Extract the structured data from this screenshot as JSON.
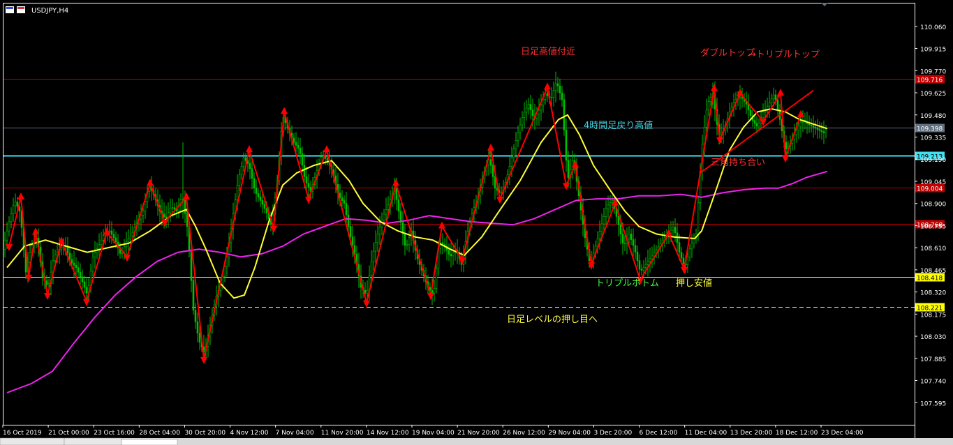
{
  "window": {
    "title": "USDJPY,H4"
  },
  "colors": {
    "background": "#000000",
    "frame": "#ffffff",
    "candle": "#00c000",
    "red_level": "#c00000",
    "cyan_level": "#40e0f0",
    "yellow_level": "#ffff00",
    "gray_level": "#607080",
    "ma_short": "#ffff33",
    "ma_long": "#ee22ee",
    "arrow": "#ff0000",
    "annotation_red": "#ff3030",
    "annotation_cyan": "#40d0e0",
    "annotation_green": "#40ff40",
    "annotation_yellow": "#ffff40"
  },
  "chart_data": {
    "type": "candlestick",
    "symbol": "USDJPY",
    "timeframe": "H4",
    "ylim": [
      107.45,
      110.21
    ],
    "y_ticks": [
      "110.060",
      "109.915",
      "109.770",
      "109.625",
      "109.480",
      "109.335",
      "109.190",
      "109.045",
      "108.900",
      "108.755",
      "108.610",
      "108.465",
      "108.320",
      "108.175",
      "108.030",
      "107.885",
      "107.740",
      "107.595"
    ],
    "x_ticks": [
      "16 Oct 2019",
      "21 Oct 00:00",
      "23 Oct 16:00",
      "28 Oct 04:00",
      "30 Oct 20:00",
      "4 Nov 12:00",
      "7 Nov 04:00",
      "11 Nov 20:00",
      "14 Nov 12:00",
      "19 Nov 04:00",
      "21 Nov 20:00",
      "26 Nov 12:00",
      "29 Nov 04:00",
      "3 Dec 20:00",
      "6 Dec 12:00",
      "11 Dec 04:00",
      "13 Dec 20:00",
      "18 Dec 12:00",
      "23 Dec 04:00"
    ],
    "horizontal_levels": [
      {
        "value": 109.716,
        "label": "109.716",
        "style": "solid",
        "color": "#c00000"
      },
      {
        "value": 109.398,
        "label": "109.398",
        "style": "solid",
        "color": "#607080"
      },
      {
        "value": 109.213,
        "label": "109.213",
        "style": "solid",
        "color": "#40e0f0"
      },
      {
        "value": 109.004,
        "label": "109.004",
        "style": "solid",
        "color": "#c00000"
      },
      {
        "value": 108.768,
        "label": "108.768",
        "style": "solid",
        "color": "#c00000"
      },
      {
        "value": 108.418,
        "label": "108.418",
        "style": "solid",
        "color": "#ffff00"
      },
      {
        "value": 108.221,
        "label": "108.221",
        "style": "dashed",
        "color": "#ffff00"
      }
    ],
    "price_path": [
      [
        0,
        108.62
      ],
      [
        8,
        108.78
      ],
      [
        16,
        108.92
      ],
      [
        24,
        108.84
      ],
      [
        32,
        108.45
      ],
      [
        40,
        108.62
      ],
      [
        48,
        108.68
      ],
      [
        56,
        108.42
      ],
      [
        64,
        108.35
      ],
      [
        72,
        108.55
      ],
      [
        80,
        108.6
      ],
      [
        88,
        108.63
      ],
      [
        96,
        108.52
      ],
      [
        104,
        108.48
      ],
      [
        112,
        108.4
      ],
      [
        120,
        108.3
      ],
      [
        128,
        108.55
      ],
      [
        136,
        108.62
      ],
      [
        144,
        108.7
      ],
      [
        152,
        108.72
      ],
      [
        160,
        108.66
      ],
      [
        168,
        108.56
      ],
      [
        176,
        108.65
      ],
      [
        184,
        108.7
      ],
      [
        192,
        108.78
      ],
      [
        200,
        108.85
      ],
      [
        208,
        109.02
      ],
      [
        216,
        108.95
      ],
      [
        224,
        108.85
      ],
      [
        232,
        108.8
      ],
      [
        240,
        108.88
      ],
      [
        248,
        108.85
      ],
      [
        256,
        108.95
      ],
      [
        264,
        108.72
      ],
      [
        272,
        108.2
      ],
      [
        280,
        108.0
      ],
      [
        288,
        107.92
      ],
      [
        296,
        108.1
      ],
      [
        304,
        108.28
      ],
      [
        312,
        108.38
      ],
      [
        320,
        108.55
      ],
      [
        328,
        108.8
      ],
      [
        336,
        109.05
      ],
      [
        344,
        109.2
      ],
      [
        352,
        109.15
      ],
      [
        360,
        108.98
      ],
      [
        368,
        108.92
      ],
      [
        376,
        108.85
      ],
      [
        384,
        108.75
      ],
      [
        392,
        109.05
      ],
      [
        400,
        109.48
      ],
      [
        408,
        109.38
      ],
      [
        416,
        109.3
      ],
      [
        424,
        109.25
      ],
      [
        432,
        109.05
      ],
      [
        440,
        108.98
      ],
      [
        448,
        109.1
      ],
      [
        456,
        109.22
      ],
      [
        464,
        109.18
      ],
      [
        472,
        109.1
      ],
      [
        480,
        108.95
      ],
      [
        488,
        108.9
      ],
      [
        496,
        108.7
      ],
      [
        504,
        108.55
      ],
      [
        512,
        108.35
      ],
      [
        520,
        108.3
      ],
      [
        528,
        108.55
      ],
      [
        536,
        108.7
      ],
      [
        544,
        108.82
      ],
      [
        552,
        108.9
      ],
      [
        560,
        109.0
      ],
      [
        568,
        108.8
      ],
      [
        576,
        108.6
      ],
      [
        584,
        108.72
      ],
      [
        592,
        108.55
      ],
      [
        600,
        108.45
      ],
      [
        608,
        108.35
      ],
      [
        616,
        108.3
      ],
      [
        624,
        108.65
      ],
      [
        632,
        108.62
      ],
      [
        640,
        108.55
      ],
      [
        648,
        108.6
      ],
      [
        656,
        108.5
      ],
      [
        664,
        108.7
      ],
      [
        672,
        108.85
      ],
      [
        680,
        108.95
      ],
      [
        688,
        109.1
      ],
      [
        696,
        109.2
      ],
      [
        704,
        109.0
      ],
      [
        712,
        108.96
      ],
      [
        720,
        109.05
      ],
      [
        728,
        109.2
      ],
      [
        736,
        109.35
      ],
      [
        744,
        109.48
      ],
      [
        752,
        109.55
      ],
      [
        760,
        109.45
      ],
      [
        768,
        109.52
      ],
      [
        776,
        109.62
      ],
      [
        784,
        109.58
      ],
      [
        792,
        109.7
      ],
      [
        800,
        109.58
      ],
      [
        808,
        109.05
      ],
      [
        816,
        109.2
      ],
      [
        824,
        108.95
      ],
      [
        832,
        108.7
      ],
      [
        840,
        108.5
      ],
      [
        848,
        108.62
      ],
      [
        856,
        108.75
      ],
      [
        864,
        108.88
      ],
      [
        872,
        108.92
      ],
      [
        880,
        108.78
      ],
      [
        888,
        108.62
      ],
      [
        896,
        108.7
      ],
      [
        904,
        108.6
      ],
      [
        912,
        108.45
      ],
      [
        920,
        108.5
      ],
      [
        928,
        108.55
      ],
      [
        936,
        108.6
      ],
      [
        944,
        108.66
      ],
      [
        952,
        108.7
      ],
      [
        960,
        108.75
      ],
      [
        968,
        108.58
      ],
      [
        976,
        108.48
      ],
      [
        984,
        108.62
      ],
      [
        992,
        108.7
      ],
      [
        1000,
        109.25
      ],
      [
        1008,
        109.55
      ],
      [
        1016,
        109.62
      ],
      [
        1024,
        109.35
      ],
      [
        1032,
        109.38
      ],
      [
        1040,
        109.5
      ],
      [
        1048,
        109.58
      ],
      [
        1056,
        109.6
      ],
      [
        1064,
        109.55
      ],
      [
        1072,
        109.45
      ],
      [
        1080,
        109.4
      ],
      [
        1088,
        109.5
      ],
      [
        1096,
        109.55
      ],
      [
        1104,
        109.62
      ],
      [
        1112,
        109.45
      ],
      [
        1120,
        109.25
      ],
      [
        1128,
        109.3
      ],
      [
        1136,
        109.38
      ],
      [
        1144,
        109.45
      ],
      [
        1152,
        109.42
      ],
      [
        1160,
        109.4
      ],
      [
        1168,
        109.38
      ],
      [
        1176,
        109.36
      ],
      [
        1180,
        109.398
      ]
    ],
    "ma_short": [
      [
        5,
        108.48
      ],
      [
        30,
        108.62
      ],
      [
        60,
        108.66
      ],
      [
        90,
        108.62
      ],
      [
        120,
        108.58
      ],
      [
        150,
        108.61
      ],
      [
        180,
        108.64
      ],
      [
        210,
        108.72
      ],
      [
        240,
        108.82
      ],
      [
        262,
        108.86
      ],
      [
        275,
        108.75
      ],
      [
        290,
        108.6
      ],
      [
        310,
        108.38
      ],
      [
        330,
        108.28
      ],
      [
        345,
        108.3
      ],
      [
        360,
        108.48
      ],
      [
        380,
        108.78
      ],
      [
        400,
        109.02
      ],
      [
        420,
        109.1
      ],
      [
        445,
        109.15
      ],
      [
        470,
        109.18
      ],
      [
        495,
        109.05
      ],
      [
        515,
        108.9
      ],
      [
        540,
        108.78
      ],
      [
        565,
        108.72
      ],
      [
        590,
        108.68
      ],
      [
        615,
        108.66
      ],
      [
        640,
        108.6
      ],
      [
        660,
        108.56
      ],
      [
        685,
        108.68
      ],
      [
        710,
        108.85
      ],
      [
        740,
        109.05
      ],
      [
        770,
        109.3
      ],
      [
        795,
        109.45
      ],
      [
        808,
        109.48
      ],
      [
        825,
        109.35
      ],
      [
        845,
        109.15
      ],
      [
        870,
        108.98
      ],
      [
        890,
        108.85
      ],
      [
        910,
        108.75
      ],
      [
        935,
        108.7
      ],
      [
        960,
        108.68
      ],
      [
        990,
        108.67
      ],
      [
        1000,
        108.72
      ],
      [
        1020,
        108.98
      ],
      [
        1040,
        109.25
      ],
      [
        1060,
        109.4
      ],
      [
        1080,
        109.5
      ],
      [
        1100,
        109.52
      ],
      [
        1120,
        109.5
      ],
      [
        1140,
        109.45
      ],
      [
        1160,
        109.42
      ],
      [
        1180,
        109.39
      ]
    ],
    "ma_long": [
      [
        5,
        107.66
      ],
      [
        40,
        107.72
      ],
      [
        70,
        107.8
      ],
      [
        100,
        107.98
      ],
      [
        130,
        108.15
      ],
      [
        160,
        108.3
      ],
      [
        190,
        108.42
      ],
      [
        220,
        108.52
      ],
      [
        250,
        108.58
      ],
      [
        280,
        108.6
      ],
      [
        310,
        108.58
      ],
      [
        340,
        108.55
      ],
      [
        370,
        108.57
      ],
      [
        400,
        108.62
      ],
      [
        430,
        108.7
      ],
      [
        460,
        108.75
      ],
      [
        490,
        108.8
      ],
      [
        520,
        108.79
      ],
      [
        550,
        108.77
      ],
      [
        580,
        108.79
      ],
      [
        610,
        108.82
      ],
      [
        640,
        108.8
      ],
      [
        670,
        108.78
      ],
      [
        700,
        108.77
      ],
      [
        730,
        108.76
      ],
      [
        760,
        108.8
      ],
      [
        790,
        108.86
      ],
      [
        820,
        108.92
      ],
      [
        850,
        108.93
      ],
      [
        880,
        108.93
      ],
      [
        910,
        108.95
      ],
      [
        940,
        108.95
      ],
      [
        970,
        108.96
      ],
      [
        1000,
        108.94
      ],
      [
        1030,
        108.97
      ],
      [
        1060,
        108.99
      ],
      [
        1090,
        109.0
      ],
      [
        1110,
        109.0
      ],
      [
        1130,
        109.03
      ],
      [
        1150,
        109.07
      ],
      [
        1180,
        109.11
      ]
    ],
    "arrows": [
      [
        8,
        108.62,
        "down"
      ],
      [
        25,
        108.94,
        "up"
      ],
      [
        36,
        108.42,
        "down"
      ],
      [
        46,
        108.71,
        "up"
      ],
      [
        63,
        108.3,
        "down"
      ],
      [
        83,
        108.65,
        "up"
      ],
      [
        119,
        108.26,
        "down"
      ],
      [
        148,
        108.71,
        "up"
      ],
      [
        177,
        108.55,
        "down"
      ],
      [
        210,
        109.03,
        "up"
      ],
      [
        231,
        108.78,
        "down"
      ],
      [
        262,
        108.94,
        "up"
      ],
      [
        287,
        107.88,
        "down"
      ],
      [
        352,
        109.25,
        "up"
      ],
      [
        387,
        108.74,
        "down"
      ],
      [
        402,
        109.5,
        "up"
      ],
      [
        437,
        108.93,
        "down"
      ],
      [
        463,
        109.25,
        "up"
      ],
      [
        520,
        108.25,
        "down"
      ],
      [
        562,
        109.03,
        "up"
      ],
      [
        612,
        108.3,
        "down"
      ],
      [
        628,
        108.75,
        "up"
      ],
      [
        657,
        108.53,
        "down"
      ],
      [
        698,
        109.26,
        "up"
      ],
      [
        711,
        108.93,
        "down"
      ],
      [
        779,
        109.66,
        "up"
      ],
      [
        806,
        109.02,
        "down"
      ],
      [
        819,
        109.15,
        "up"
      ],
      [
        842,
        108.5,
        "down"
      ],
      [
        876,
        108.9,
        "up"
      ],
      [
        912,
        108.4,
        "down"
      ],
      [
        953,
        108.7,
        "up"
      ],
      [
        975,
        108.47,
        "down"
      ],
      [
        1018,
        109.65,
        "up"
      ],
      [
        1026,
        109.32,
        "down"
      ],
      [
        1055,
        109.62,
        "up"
      ],
      [
        1088,
        109.44,
        "down"
      ],
      [
        1113,
        109.62,
        "up"
      ],
      [
        1120,
        109.2,
        "down"
      ],
      [
        1142,
        109.48,
        "up"
      ]
    ],
    "trendlines": [
      [
        998,
        109.1,
        1160,
        109.64
      ]
    ]
  },
  "annotations": {
    "daily_high": "日足高値付近",
    "double_top": "ダブルトップ",
    "triple_top": "→トリプルトップ",
    "h4_pullback_high": "4時間足戻り高値",
    "triangle": "三角持ち合い",
    "triple_bottom": "トリプルボトム",
    "pullback_low": "押し安値",
    "daily_pullback": "日足レベルの押し目へ"
  }
}
